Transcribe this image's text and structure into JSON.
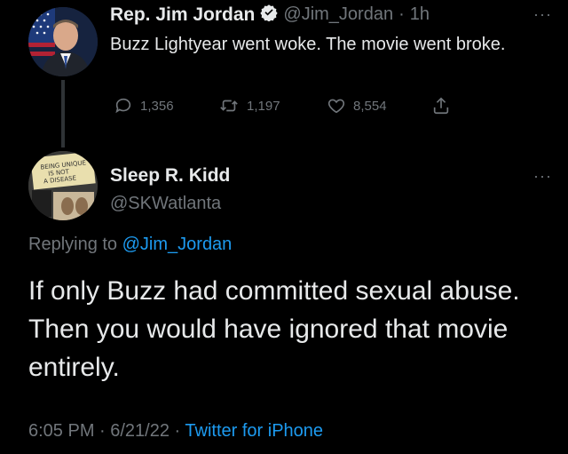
{
  "tweet": {
    "author_name": "Rep. Jim Jordan",
    "handle": "@Jim_Jordan",
    "separator": "·",
    "time": "1h",
    "text": "Buzz Lightyear went woke. The movie went broke.",
    "actions": {
      "replies": "1,356",
      "retweets": "1,197",
      "likes": "8,554"
    },
    "verified": true
  },
  "reply": {
    "author_name": "Sleep R. Kidd",
    "handle": "@SKWatlanta",
    "replying_prefix": "Replying to",
    "replying_to": "@Jim_Jordan",
    "text": "If only Buzz had committed sexual abuse.  Then you would have ignored that movie entirely.",
    "timestamp": "6:05 PM · 6/21/22 · ",
    "source": "Twitter for iPhone",
    "avatar_sign_text": "BEING UNIQUE IS NOT A DISEASE"
  },
  "more_label": "···",
  "colors": {
    "background": "#000000",
    "text": "#e7e9ea",
    "muted": "#71767b",
    "link": "#1d9bf0",
    "verified": "#1d9bf0"
  },
  "icons": [
    "reply-icon",
    "retweet-icon",
    "like-icon",
    "share-icon",
    "verified-badge-icon",
    "more-icon"
  ]
}
